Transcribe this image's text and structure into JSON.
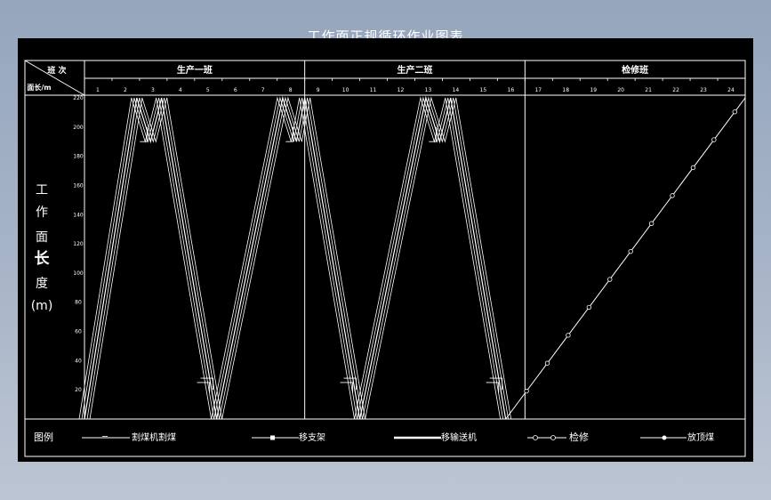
{
  "title": "工作面正规循环作业图表",
  "header": {
    "corner_top": "班 次",
    "corner_bottom": "面长/m",
    "shifts": [
      "生产一班",
      "生产二班",
      "检修班"
    ],
    "hours": [
      "1",
      "2",
      "3",
      "4",
      "5",
      "6",
      "7",
      "8",
      "9",
      "10",
      "11",
      "12",
      "13",
      "14",
      "15",
      "16",
      "17",
      "18",
      "19",
      "20",
      "21",
      "22",
      "23",
      "24"
    ]
  },
  "y_axis": {
    "chars": [
      "工",
      "作",
      "面",
      "长",
      "度",
      "(m)"
    ],
    "ticks": [
      "220",
      "200",
      "180",
      "160",
      "140",
      "120",
      "100",
      "80",
      "60",
      "40",
      "20"
    ]
  },
  "legend": {
    "label": "图例",
    "items": [
      {
        "name": "割煤机割煤",
        "style": "thin-line"
      },
      {
        "name": "移支架",
        "style": "line-with-square"
      },
      {
        "name": "移输送机",
        "style": "thick-line"
      },
      {
        "name": "检修",
        "style": "line-with-circle"
      },
      {
        "name": "放顶煤",
        "style": "line-with-dot"
      }
    ]
  },
  "colors": {
    "line": "#ffffff",
    "background": "#000000"
  },
  "chart_data": {
    "type": "line",
    "x_unit": "hour",
    "y_unit": "m",
    "xlim": [
      0,
      24
    ],
    "ylim": [
      0,
      220
    ],
    "series": [
      {
        "name": "割煤机割煤",
        "x": [
          0,
          1.9,
          2.4,
          2.8,
          4.8,
          7.2,
          7.7,
          8.0,
          10.0,
          12.4,
          12.9,
          13.3,
          15.3
        ],
        "y": [
          0,
          220,
          190,
          220,
          0,
          220,
          190,
          220,
          0,
          220,
          190,
          220,
          0
        ]
      },
      {
        "name": "检修",
        "x": [
          15.3,
          24
        ],
        "y": [
          0,
          220
        ]
      }
    ]
  }
}
